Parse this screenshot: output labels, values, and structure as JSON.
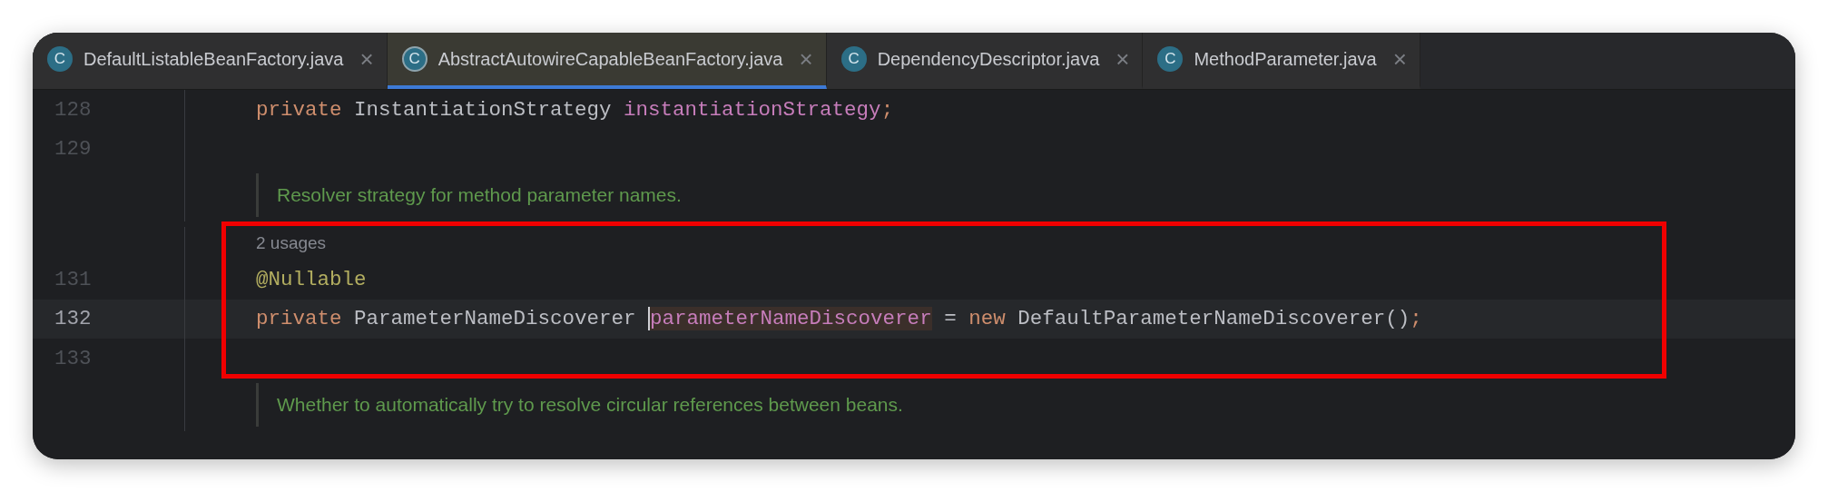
{
  "tabs": [
    {
      "icon": "C",
      "label": "DefaultListableBeanFactory.java",
      "close": "×",
      "selected": false
    },
    {
      "icon": "C",
      "label": "AbstractAutowireCapableBeanFactory.java",
      "close": "×",
      "selected": true
    },
    {
      "icon": "C",
      "label": "DependencyDescriptor.java",
      "close": "×",
      "selected": false
    },
    {
      "icon": "C",
      "label": "MethodParameter.java",
      "close": "×",
      "selected": false
    }
  ],
  "editor": {
    "sections": [
      {
        "kind": "plain",
        "rows": [
          {
            "kind": "code",
            "number": "128",
            "current": false,
            "tokens": [
              {
                "kind": "keyword",
                "text": "private"
              },
              {
                "kind": "plain",
                "text": " InstantiationStrategy "
              },
              {
                "kind": "field",
                "text": "instantiationStrategy"
              },
              {
                "kind": "keyword",
                "text": ";"
              }
            ]
          },
          {
            "kind": "code",
            "number": "129",
            "current": false,
            "tokens": []
          },
          {
            "kind": "doc",
            "text": "Resolver strategy for method parameter names."
          }
        ]
      },
      {
        "kind": "framed",
        "rows": [
          {
            "kind": "hint",
            "text": "2 usages"
          },
          {
            "kind": "code",
            "number": "131",
            "current": false,
            "tokens": [
              {
                "kind": "annotation",
                "text": "@Nullable"
              }
            ]
          },
          {
            "kind": "code",
            "number": "132",
            "current": true,
            "tokens": [
              {
                "kind": "keyword",
                "text": "private"
              },
              {
                "kind": "plain",
                "text": " ParameterNameDiscoverer "
              },
              {
                "kind": "field",
                "text": "parameterNameDiscoverer",
                "caret": true,
                "highlighted": true
              },
              {
                "kind": "plain",
                "text": " = "
              },
              {
                "kind": "keyword",
                "text": "new"
              },
              {
                "kind": "plain",
                "text": " DefaultParameterNameDiscoverer()"
              },
              {
                "kind": "keyword",
                "text": ";"
              }
            ]
          },
          {
            "kind": "code",
            "number": "133",
            "current": false,
            "tokens": []
          }
        ]
      },
      {
        "kind": "plain",
        "rows": [
          {
            "kind": "doc",
            "text": "Whether to automatically try to resolve circular references between beans."
          }
        ]
      }
    ]
  }
}
